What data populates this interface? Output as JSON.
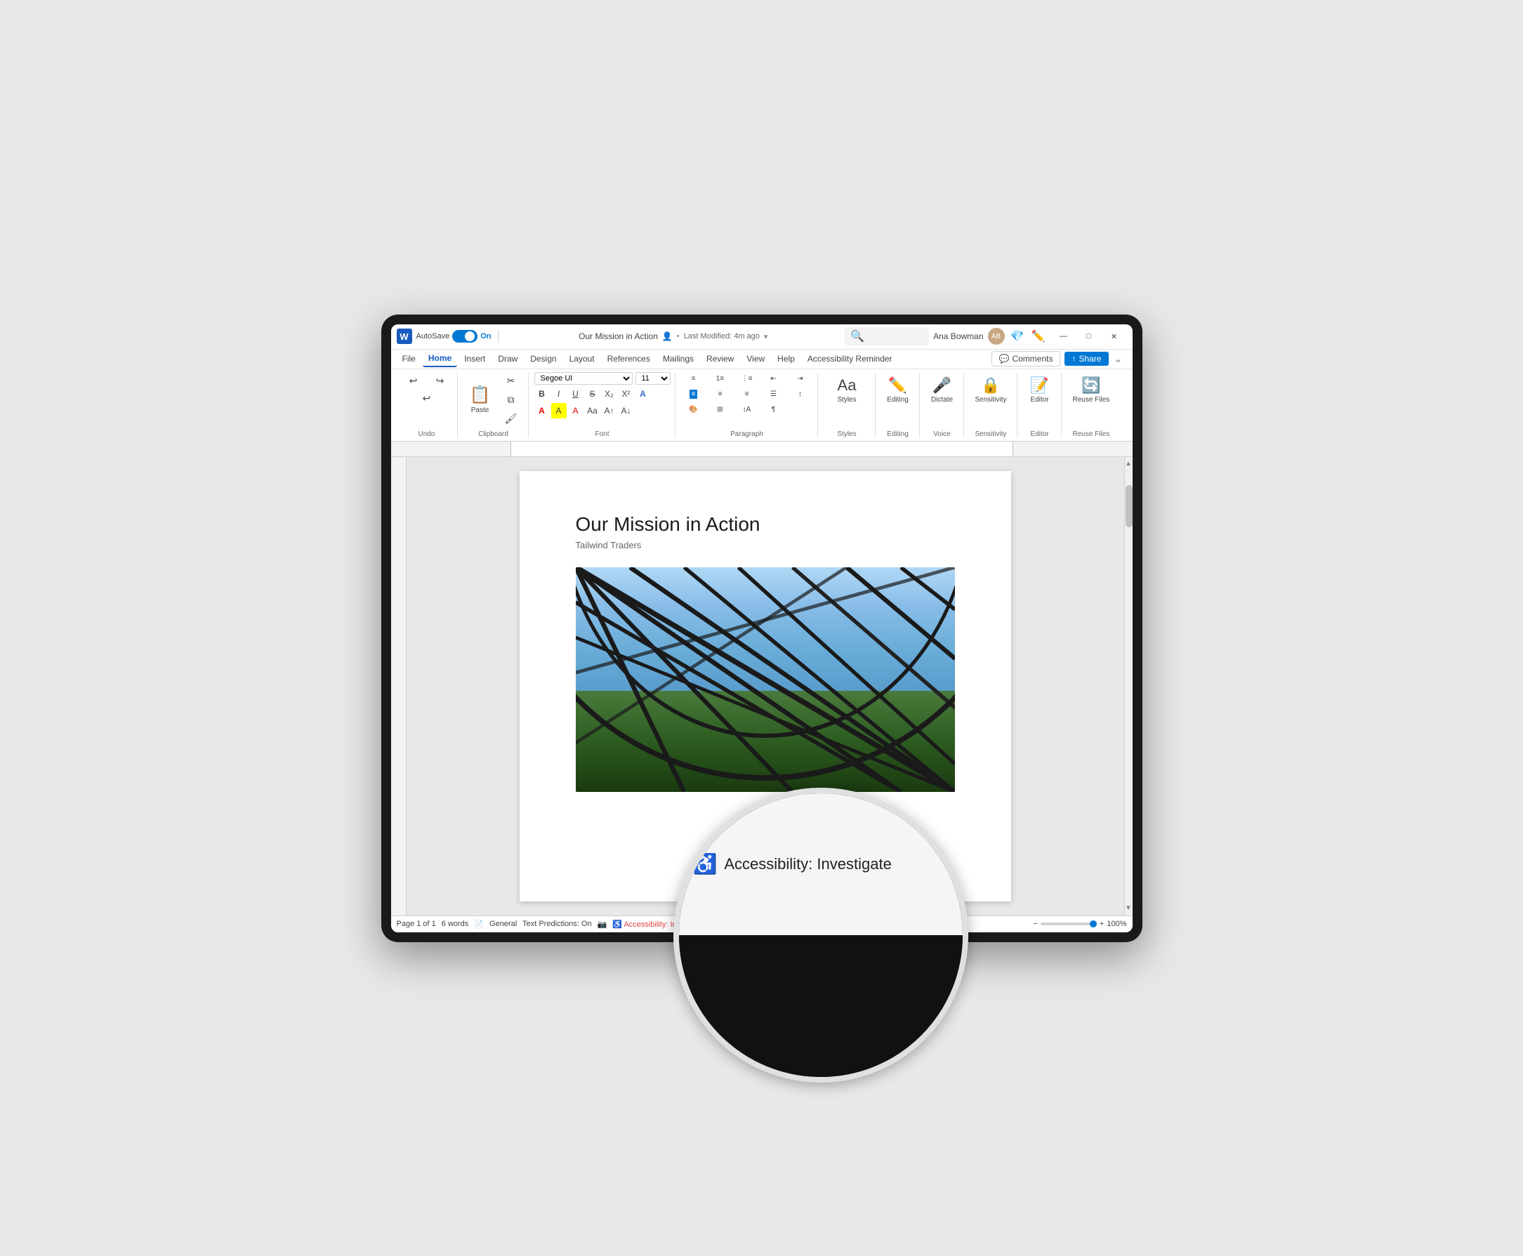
{
  "device": {
    "title": "Microsoft Word - Our Mission in Action"
  },
  "titlebar": {
    "app_logo": "W",
    "autosave_label": "AutoSave",
    "toggle_state": "On",
    "doc_title": "Our Mission in Action",
    "last_modified": "Last Modified: 4m ago",
    "user_name": "Ana Bowman",
    "search_placeholder": "Search"
  },
  "menubar": {
    "items": [
      {
        "label": "File",
        "active": false
      },
      {
        "label": "Home",
        "active": true
      },
      {
        "label": "Insert",
        "active": false
      },
      {
        "label": "Draw",
        "active": false
      },
      {
        "label": "Design",
        "active": false
      },
      {
        "label": "Layout",
        "active": false
      },
      {
        "label": "References",
        "active": false
      },
      {
        "label": "Mailings",
        "active": false
      },
      {
        "label": "Review",
        "active": false
      },
      {
        "label": "View",
        "active": false
      },
      {
        "label": "Help",
        "active": false
      },
      {
        "label": "Accessibility Reminder",
        "active": false
      }
    ],
    "comments_label": "Comments",
    "share_label": "Share"
  },
  "ribbon": {
    "undo_label": "Undo",
    "clipboard_label": "Clipboard",
    "paste_label": "Paste",
    "font_label": "Font",
    "font_name": "Segoe UI",
    "font_size": "11",
    "paragraph_label": "Paragraph",
    "styles_label": "Styles",
    "editing_label": "Editing",
    "voice_label": "Voice",
    "dictate_label": "Dictate",
    "sensitivity_label": "Sensitivity",
    "editor_label": "Editor",
    "reuse_files_label": "Reuse Files",
    "format_buttons": [
      "B",
      "I",
      "U",
      "S",
      "X₂",
      "X²",
      "A"
    ]
  },
  "document": {
    "title": "Our Mission in Action",
    "subtitle": "Tailwind Traders",
    "image_alt": "Architectural glass ceiling with steel beams and garden below"
  },
  "statusbar": {
    "page_info": "Page 1 of 1",
    "word_count": "6 words",
    "language": "General",
    "text_predictions": "Text Predictions: On",
    "accessibility": "Accessibility: Investigate",
    "zoom_percent": "100%"
  },
  "magnifier": {
    "accessibility_icon": "♿",
    "accessibility_label": "Accessibility: Investigate"
  },
  "window_controls": {
    "minimize": "—",
    "maximize": "□",
    "close": "✕"
  }
}
